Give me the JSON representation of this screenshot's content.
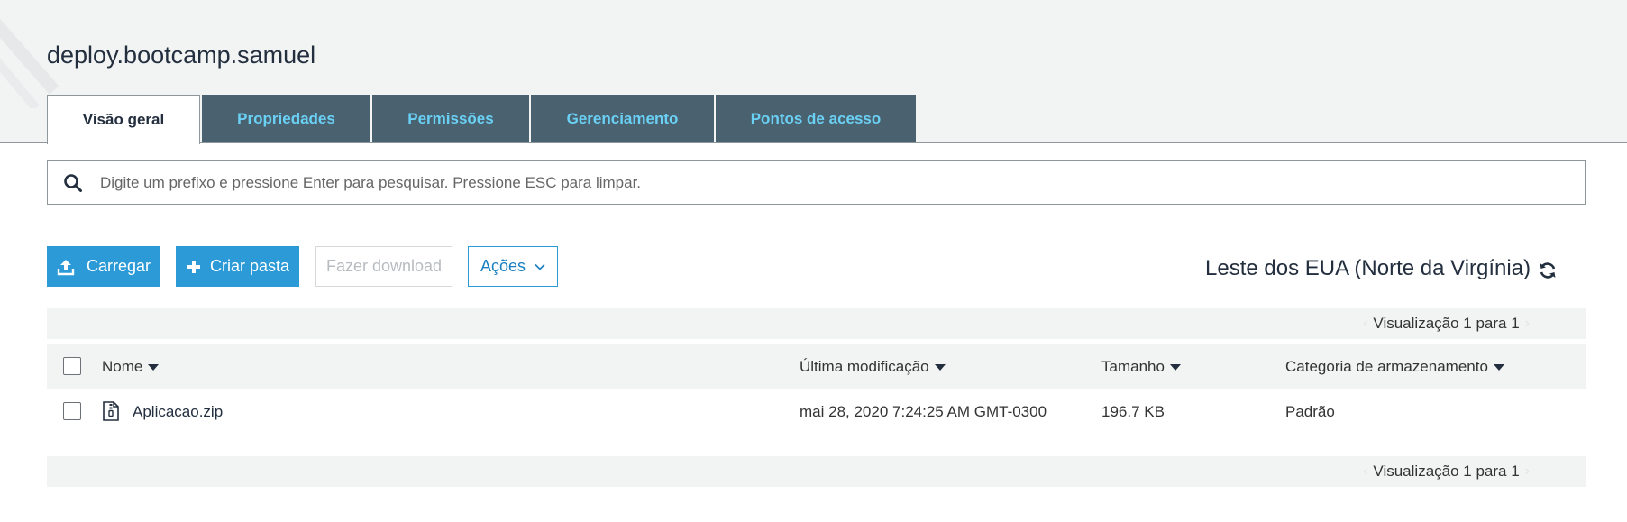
{
  "bucket": {
    "title": "deploy.bootcamp.samuel"
  },
  "tabs": [
    {
      "label": "Visão geral"
    },
    {
      "label": "Propriedades"
    },
    {
      "label": "Permissões"
    },
    {
      "label": "Gerenciamento"
    },
    {
      "label": "Pontos de acesso"
    }
  ],
  "search": {
    "placeholder": "Digite um prefixo e pressione Enter para pesquisar. Pressione ESC para limpar.",
    "value": ""
  },
  "toolbar": {
    "upload_label": "Carregar",
    "create_folder_label": "Criar pasta",
    "download_label": "Fazer download",
    "actions_label": "Ações"
  },
  "region": {
    "label": "Leste dos EUA (Norte da Virgínia)"
  },
  "pagination": {
    "top": "Visualização 1 para 1",
    "bottom": "Visualização 1 para 1"
  },
  "table": {
    "columns": {
      "name": "Nome",
      "last_modified": "Última modificação",
      "size": "Tamanho",
      "storage_class": "Categoria de armazenamento"
    },
    "rows": [
      {
        "name": "Aplicacao.zip",
        "last_modified": "mai 28, 2020 7:24:25 AM GMT-0300",
        "size": "196.7 KB",
        "storage_class": "Padrão"
      }
    ]
  },
  "colors": {
    "primary": "#2b9ad7",
    "tab_bg": "#4a6170",
    "tab_text": "#6ad1f5",
    "band": "#f2f3f3"
  },
  "icons": {
    "search": "search-icon",
    "upload": "upload-icon",
    "plus": "plus-icon",
    "chevron": "chevron-down-icon",
    "refresh": "refresh-icon",
    "file": "zip-file-icon"
  }
}
